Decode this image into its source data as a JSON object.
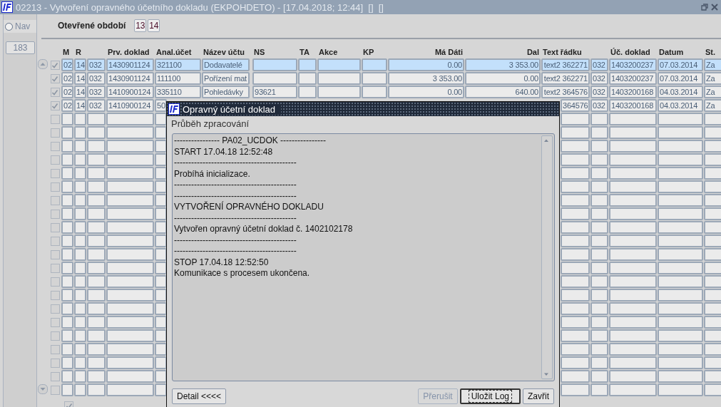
{
  "window": {
    "title": "02213 - Vytvoření opravného účetního dokladu (EKPOHDETO) - [17.04.2018; 12:44]  []  []"
  },
  "nav": {
    "label": "Nav",
    "selected": false,
    "count": "183"
  },
  "period": {
    "label": "Otevřené období",
    "values": [
      "13",
      "14"
    ]
  },
  "table": {
    "columns": [
      "M",
      "R",
      null,
      "Prv. doklad",
      "Anal.účet",
      "Název účtu",
      "NS",
      "TA",
      "Akce",
      "KP",
      "Má Dáti",
      "Dal",
      "Text řádku",
      null,
      "Úč. doklad",
      "Datum",
      "St."
    ],
    "rows": [
      {
        "checked": true,
        "selected": true,
        "cells": [
          "02",
          "14",
          "032",
          "1430901124",
          "321100",
          "Dodavatelé",
          null,
          null,
          null,
          null,
          "0.00",
          "3 353.00",
          "text2 362271",
          "032",
          "1403200237",
          "07.03.2014",
          "Za"
        ]
      },
      {
        "checked": true,
        "selected": false,
        "cells": [
          "02",
          "14",
          "032",
          "1430901124",
          "111100",
          "Pořízení mat",
          null,
          null,
          null,
          null,
          "3 353.00",
          "0.00",
          "text2 362271",
          "032",
          "1403200237",
          "07.03.2014",
          "Za"
        ]
      },
      {
        "checked": true,
        "selected": false,
        "cells": [
          "02",
          "14",
          "032",
          "1410900124",
          "335110",
          "Pohledávky",
          "93621",
          null,
          null,
          null,
          "0.00",
          "640.00",
          "text2 364576",
          "032",
          "1403200168",
          "04.03.2014",
          "Za"
        ]
      },
      {
        "checked": true,
        "selected": false,
        "cells": [
          "02",
          "14",
          "032",
          "1410900124",
          "50",
          null,
          null,
          null,
          null,
          null,
          null,
          null,
          "364576",
          "032",
          "1403200168",
          "04.03.2014",
          "Za"
        ]
      },
      {
        "checked": false,
        "selected": false
      },
      {
        "checked": false,
        "selected": false
      },
      {
        "checked": false,
        "selected": false
      },
      {
        "checked": false,
        "selected": false
      },
      {
        "checked": false,
        "selected": false
      },
      {
        "checked": false,
        "selected": false
      },
      {
        "checked": false,
        "selected": false
      },
      {
        "checked": false,
        "selected": false
      },
      {
        "checked": false,
        "selected": false
      },
      {
        "checked": false,
        "selected": false
      },
      {
        "checked": false,
        "selected": false
      },
      {
        "checked": false,
        "selected": false
      },
      {
        "checked": false,
        "selected": false
      },
      {
        "checked": false,
        "selected": false
      },
      {
        "checked": false,
        "selected": false
      },
      {
        "checked": false,
        "selected": false
      },
      {
        "checked": false,
        "selected": false
      },
      {
        "checked": false,
        "selected": false
      },
      {
        "checked": false,
        "selected": false
      },
      {
        "checked": false,
        "selected": false
      },
      {
        "checked": false,
        "selected": false
      }
    ]
  },
  "bottom_option": {
    "checked": true
  },
  "dialog": {
    "title": "Opravný účetní doklad",
    "label": "Průběh zpracování",
    "log": [
      "---------------- PA02_UCDOK ----------------",
      "START 17.04.18 12:52:48",
      "-------------------------------------------",
      "Probíhá inicializace.",
      "-------------------------------------------",
      "-------------------------------------------",
      "VYTVOŘENÍ OPRAVNÉHO DOKLADU",
      "-------------------------------------------",
      "Vytvořen opravný účetní doklad č. 1402102178",
      "-------------------------------------------",
      "-------------------------------------------",
      "STOP 17.04.18 12:52:50",
      "Komunikace s procesem ukončena."
    ],
    "buttons": [
      {
        "label": "Detail <<<<",
        "disabled": false,
        "focused": false
      },
      {
        "label": "Přerušit",
        "disabled": true,
        "focused": false
      },
      {
        "label": "Uložit Log",
        "disabled": false,
        "focused": true
      },
      {
        "label": "Zavřit",
        "disabled": false,
        "focused": false
      }
    ]
  }
}
